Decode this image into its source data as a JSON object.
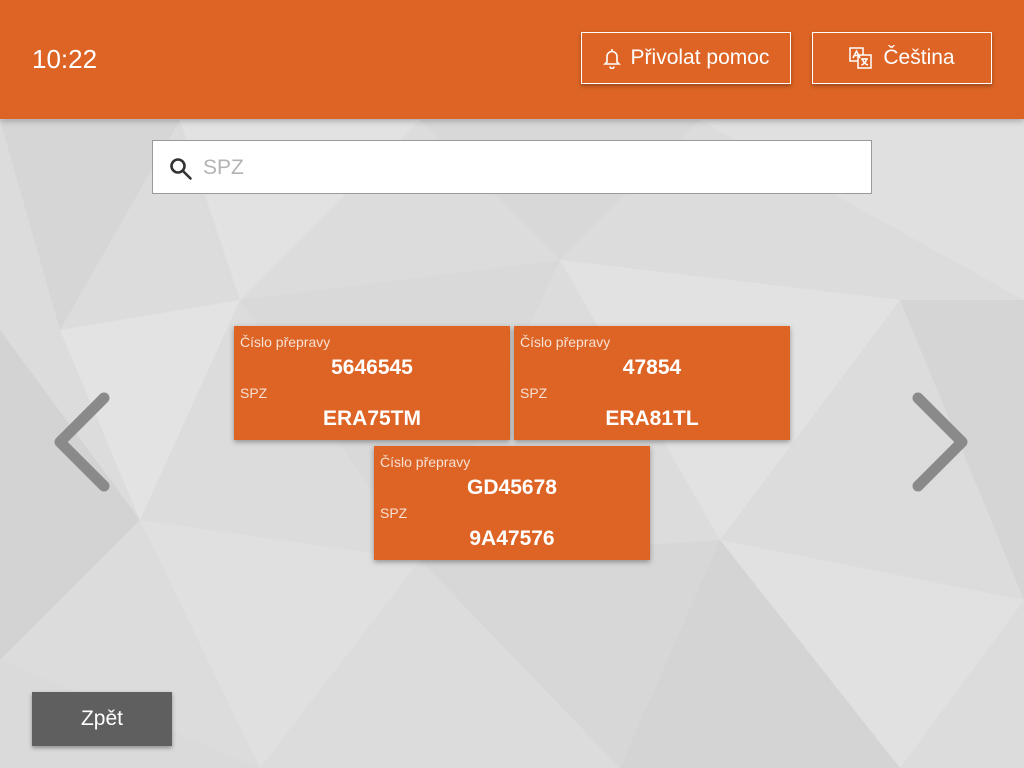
{
  "header": {
    "time": "10:22",
    "help_label": "Přivolat pomoc",
    "help_icon": "bell-icon",
    "language_label": "Čeština",
    "language_icon": "translate-icon"
  },
  "search": {
    "placeholder": "SPZ",
    "value": "",
    "icon": "search-icon"
  },
  "cards": [
    {
      "transport_label": "Číslo přepravy",
      "transport_number": "5646545",
      "plate_label": "SPZ",
      "plate": "ERA75TM"
    },
    {
      "transport_label": "Číslo přepravy",
      "transport_number": "47854",
      "plate_label": "SPZ",
      "plate": "ERA81TL"
    },
    {
      "transport_label": "Číslo přepravy",
      "transport_number": "GD45678",
      "plate_label": "SPZ",
      "plate": "9A47576"
    }
  ],
  "navigation": {
    "prev_icon": "chevron-left-icon",
    "next_icon": "chevron-right-icon"
  },
  "footer": {
    "back_label": "Zpět"
  },
  "colors": {
    "accent": "#dd6424",
    "background": "#dcdcdc",
    "back_button": "#5f5f5f"
  }
}
